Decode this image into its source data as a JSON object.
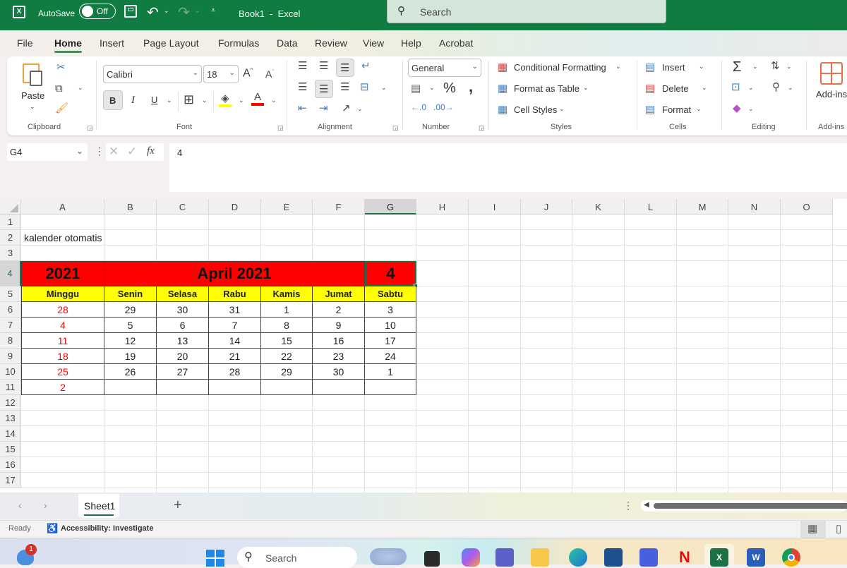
{
  "titlebar": {
    "app_icon": "excel-icon",
    "autosave_label": "AutoSave",
    "autosave_state": "Off",
    "doc_title": "Book1  -  Excel",
    "search_placeholder": "Search",
    "icons": [
      "save-icon",
      "undo-icon",
      "redo-icon",
      "customize-qat-icon",
      "search-icon"
    ]
  },
  "tabs": [
    "File",
    "Home",
    "Insert",
    "Page Layout",
    "Formulas",
    "Data",
    "Review",
    "View",
    "Help",
    "Acrobat"
  ],
  "active_tab": "Home",
  "ribbon": {
    "clipboard": {
      "label": "Clipboard",
      "paste": "Paste"
    },
    "font": {
      "label": "Font",
      "font_name": "Calibri",
      "font_size": "18",
      "bold": "B",
      "italic": "I",
      "underline": "U",
      "grow": "A",
      "shrink": "A",
      "font_color": "A"
    },
    "alignment": {
      "label": "Alignment"
    },
    "number": {
      "label": "Number",
      "format": "General",
      "percent": "%",
      "comma": ","
    },
    "styles": {
      "label": "Styles",
      "conditional": "Conditional Formatting",
      "format_table": "Format as Table",
      "cell_styles": "Cell Styles"
    },
    "cells": {
      "label": "Cells",
      "insert": "Insert",
      "delete": "Delete",
      "format": "Format"
    },
    "editing": {
      "label": "Editing",
      "sum": "Σ"
    },
    "addins": {
      "label": "Add-ins",
      "button": "Add-ins"
    }
  },
  "formula_bar": {
    "name_box": "G4",
    "fx": "fx",
    "value": "4"
  },
  "columns": [
    "A",
    "B",
    "C",
    "D",
    "E",
    "F",
    "G",
    "H",
    "I",
    "J",
    "K",
    "L",
    "M",
    "N",
    "O"
  ],
  "selected_column": "G",
  "rows": [
    "1",
    "2",
    "3",
    "4",
    "5",
    "6",
    "7",
    "8",
    "9",
    "10",
    "11",
    "12",
    "13",
    "14",
    "15",
    "16",
    "17"
  ],
  "selected_row": "4",
  "sheet": {
    "title_cell": "kalender otomatis",
    "year": "2021",
    "month_label": "April 2021",
    "selected_value": "4",
    "day_headers": [
      "Minggu",
      "Senin",
      "Selasa",
      "Rabu",
      "Kamis",
      "Jumat",
      "Sabtu"
    ],
    "weeks": [
      [
        "28",
        "29",
        "30",
        "31",
        "1",
        "2",
        "3"
      ],
      [
        "4",
        "5",
        "6",
        "7",
        "8",
        "9",
        "10"
      ],
      [
        "11",
        "12",
        "13",
        "14",
        "15",
        "16",
        "17"
      ],
      [
        "18",
        "19",
        "20",
        "21",
        "22",
        "23",
        "24"
      ],
      [
        "25",
        "26",
        "27",
        "28",
        "29",
        "30",
        "1"
      ],
      [
        "2",
        "",
        "",
        "",
        "",
        "",
        ""
      ]
    ],
    "colors": {
      "header_red": "#ff0000",
      "day_yellow": "#ffff00",
      "sunday_text": "#ff0000"
    }
  },
  "sheet_tabs": {
    "tabs": [
      "Sheet1"
    ],
    "active": "Sheet1",
    "add": "+"
  },
  "statusbar": {
    "ready": "Ready",
    "accessibility": "Accessibility: Investigate"
  },
  "taskbar": {
    "search_placeholder": "Search",
    "notification_count": "1",
    "apps": [
      "widgets",
      "start",
      "search",
      "copilot-app",
      "task-view",
      "copilot",
      "teams",
      "file-explorer",
      "edge",
      "microsoft-store",
      "app",
      "netflix",
      "excel",
      "word",
      "chrome"
    ]
  },
  "accent": "#107c41"
}
